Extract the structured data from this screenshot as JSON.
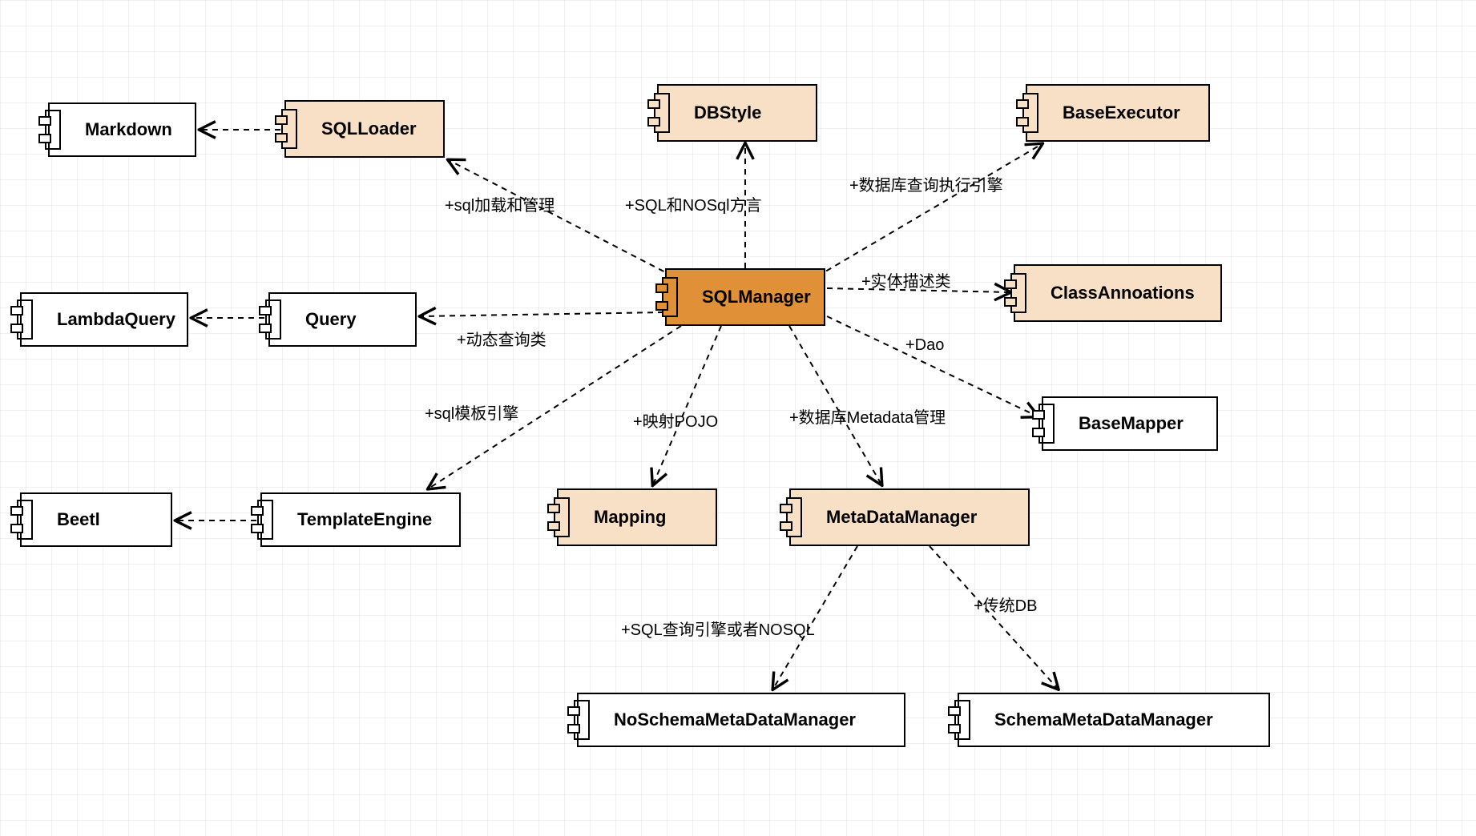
{
  "diagram": {
    "type": "UML component / dependency diagram",
    "tool_style": "diagrams.net grid canvas"
  },
  "nodes": {
    "sqlmanager": {
      "label": "SQLManager",
      "color": "orange"
    },
    "sqlloader": {
      "label": "SQLLoader",
      "color": "tan"
    },
    "dbstyle": {
      "label": "DBStyle",
      "color": "tan"
    },
    "baseexecutor": {
      "label": "BaseExecutor",
      "color": "tan"
    },
    "classannotations": {
      "label": "ClassAnnoations",
      "color": "tan"
    },
    "mapping": {
      "label": "Mapping",
      "color": "tan"
    },
    "metadatamanager": {
      "label": "MetaDataManager",
      "color": "tan"
    },
    "markdown": {
      "label": "Markdown",
      "color": "white"
    },
    "lambdaquery": {
      "label": "LambdaQuery",
      "color": "white"
    },
    "query": {
      "label": "Query",
      "color": "white"
    },
    "beetl": {
      "label": "Beetl",
      "color": "white"
    },
    "templateengine": {
      "label": "TemplateEngine",
      "color": "white"
    },
    "basemapper": {
      "label": "BaseMapper",
      "color": "white"
    },
    "noschemamdm": {
      "label": "NoSchemaMetaDataManager",
      "color": "white"
    },
    "schemamdm": {
      "label": "SchemaMetaDataManager",
      "color": "white"
    }
  },
  "edges": {
    "sql_load_mgmt": "+sql加载和管理",
    "sql_nosql_dialect": "+SQL和NOSql方言",
    "db_query_engine": "+数据库查询执行引擎",
    "entity_desc": "+实体描述类",
    "dao": "+Dao",
    "metadata_mgmt": "+数据库Metadata管理",
    "pojo_mapping": "+映射POJO",
    "sql_template": "+sql模板引擎",
    "dyn_query": "+动态查询类",
    "sql_or_nosql": "+SQL查询引擎或者NOSQL",
    "trad_db": "+传统DB"
  },
  "chart_data": {
    "type": "table",
    "edges": [
      {
        "from": "SQLManager",
        "to": "SQLLoader",
        "label": "+sql加载和管理"
      },
      {
        "from": "SQLManager",
        "to": "DBStyle",
        "label": "+SQL和NOSql方言"
      },
      {
        "from": "SQLManager",
        "to": "BaseExecutor",
        "label": "+数据库查询执行引擎"
      },
      {
        "from": "SQLManager",
        "to": "ClassAnnoations",
        "label": "+实体描述类"
      },
      {
        "from": "SQLManager",
        "to": "BaseMapper",
        "label": "+Dao"
      },
      {
        "from": "SQLManager",
        "to": "MetaDataManager",
        "label": "+数据库Metadata管理"
      },
      {
        "from": "SQLManager",
        "to": "Mapping",
        "label": "+映射POJO"
      },
      {
        "from": "SQLManager",
        "to": "TemplateEngine",
        "label": "+sql模板引擎"
      },
      {
        "from": "SQLManager",
        "to": "Query",
        "label": "+动态查询类"
      },
      {
        "from": "SQLLoader",
        "to": "Markdown",
        "label": ""
      },
      {
        "from": "Query",
        "to": "LambdaQuery",
        "label": ""
      },
      {
        "from": "TemplateEngine",
        "to": "Beetl",
        "label": ""
      },
      {
        "from": "MetaDataManager",
        "to": "NoSchemaMetaDataManager",
        "label": "+SQL查询引擎或者NOSQL"
      },
      {
        "from": "MetaDataManager",
        "to": "SchemaMetaDataManager",
        "label": "+传统DB"
      }
    ]
  }
}
